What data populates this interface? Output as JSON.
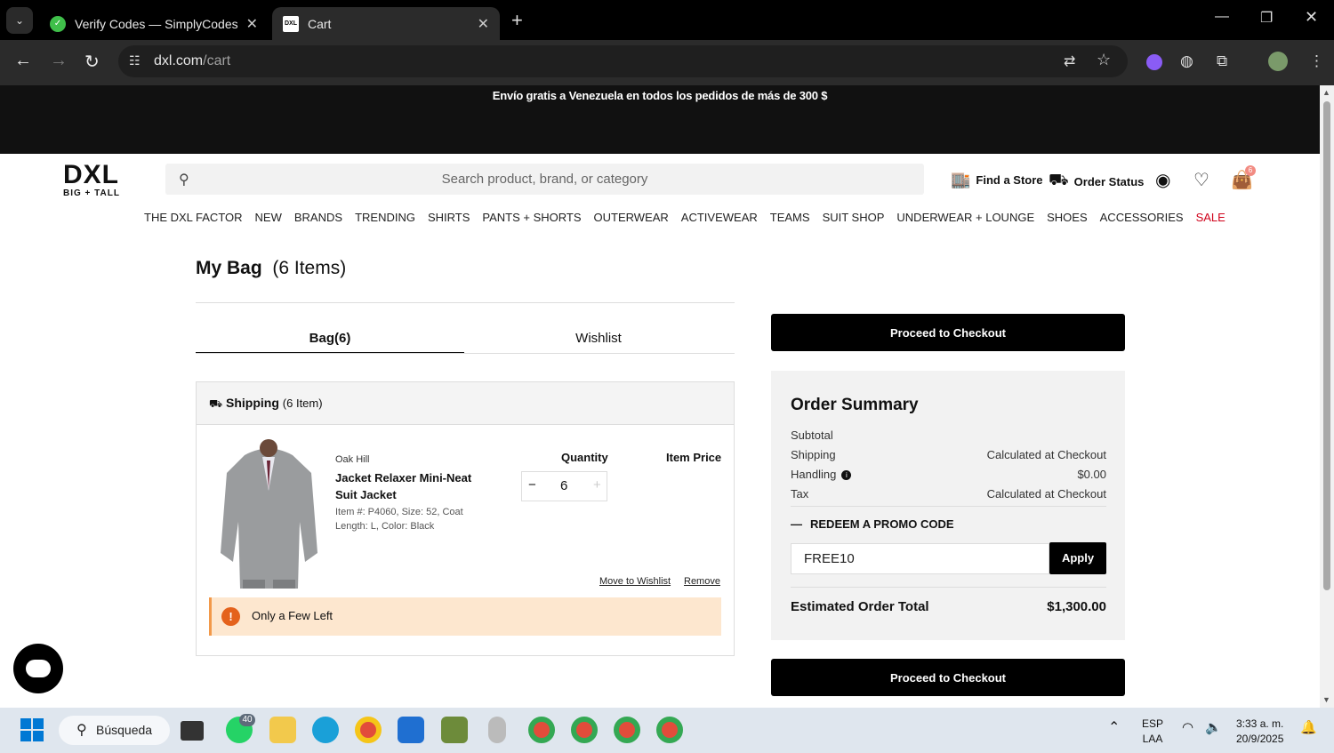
{
  "browser": {
    "tabs": [
      {
        "title": "Verify Codes — SimplyCodes",
        "active": false
      },
      {
        "title": "Cart",
        "active": true
      }
    ],
    "url_domain": "dxl.com",
    "url_path": "/cart"
  },
  "promo_bar": {
    "text": "Envío gratis a Venezuela en todos los pedidos de más de 300 $"
  },
  "header": {
    "logo": "DXL",
    "logo_sub": "BIG + TALL",
    "search_placeholder": "Search product, brand, or category",
    "find_store": "Find a Store",
    "order_status": "Order Status",
    "bag_count": "6"
  },
  "nav": [
    "THE DXL FACTOR",
    "NEW",
    "BRANDS",
    "TRENDING",
    "SHIRTS",
    "PANTS + SHORTS",
    "OUTERWEAR",
    "ACTIVEWEAR",
    "TEAMS",
    "SUIT SHOP",
    "UNDERWEAR + LOUNGE",
    "SHOES",
    "ACCESSORIES",
    "SALE"
  ],
  "page": {
    "title": "My Bag",
    "title_count": "(6 Items)",
    "tab_bag": "Bag(6)",
    "tab_wishlist": "Wishlist"
  },
  "cart": {
    "shipping_label": "Shipping",
    "shipping_count": "(6 Item)",
    "qty_header": "Quantity",
    "price_header": "Item Price",
    "item": {
      "brand": "Oak Hill",
      "name": "Jacket Relaxer Mini-Neat Suit Jacket",
      "meta": "Item #: P4060, Size: 52, Coat Length: L, Color: Black",
      "quantity": "6",
      "move_to_wishlist": "Move to Wishlist",
      "remove": "Remove",
      "stock_alert": "Only a Few Left"
    }
  },
  "summary": {
    "checkout_label": "Proceed to Checkout",
    "title": "Order Summary",
    "rows": [
      {
        "label": "Subtotal",
        "value": ""
      },
      {
        "label": "Shipping",
        "value": "Calculated at Checkout"
      },
      {
        "label": "Handling",
        "value": "$0.00"
      },
      {
        "label": "Tax",
        "value": "Calculated at Checkout"
      }
    ],
    "redeem_label": "REDEEM A PROMO CODE",
    "promo_value": "FREE10",
    "apply_label": "Apply",
    "total_label": "Estimated Order Total",
    "total_value": "$1,300.00"
  },
  "taskbar": {
    "search_label": "Búsqueda",
    "whatsapp_badge": "40",
    "lang_top": "ESP",
    "lang_bottom": "LAA",
    "time": "3:33 a. m.",
    "date": "20/9/2025"
  },
  "colors": {
    "sale": "#d0021b",
    "accent_black": "#000000",
    "alert_bg": "#fde7cf"
  }
}
